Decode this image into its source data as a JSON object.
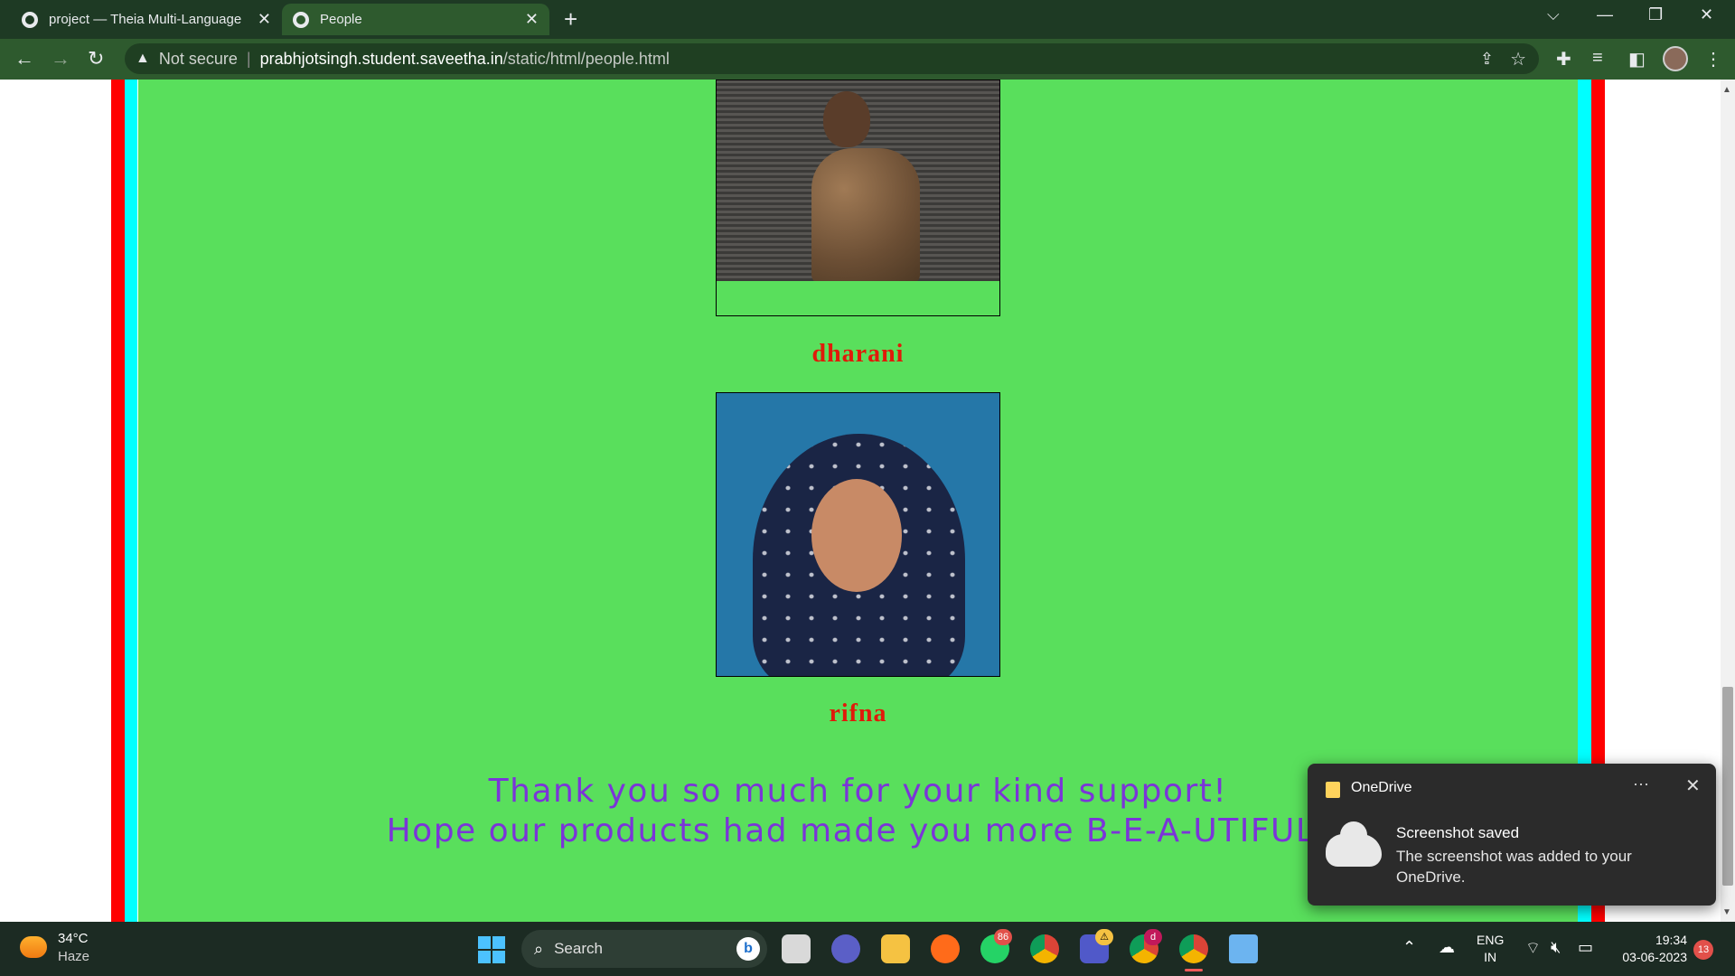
{
  "browser": {
    "tabs": [
      {
        "title": "project — Theia Multi-Language",
        "close": "✕"
      },
      {
        "title": "People",
        "close": "✕"
      }
    ],
    "new_tab": "+",
    "window_controls": {
      "dropdown": "⌵",
      "minimize": "—",
      "restore": "❐",
      "close": "✕"
    },
    "nav": {
      "back": "←",
      "forward": "→",
      "reload": "↻"
    },
    "address": {
      "warning_icon": "▲",
      "security_label": "Not secure",
      "separator": "|",
      "host": "prabhjotsingh.student.saveetha.in",
      "path": "/static/html/people.html"
    },
    "toolbar_icons": {
      "share": "⇪",
      "bookmark": "☆",
      "extensions": "✚",
      "media": "≡",
      "sidepanel": "◧",
      "menu": "⋮"
    }
  },
  "page": {
    "colors": {
      "background": "#59df5c",
      "name": "#e11a0a",
      "message": "#7b35d8",
      "left_stripe": "#ff0000",
      "inner_stripe": "#00ffff"
    },
    "people": [
      {
        "name": "dharani",
        "photo_alt": "Photo of dharani"
      },
      {
        "name": "rifna",
        "photo_alt": "Photo of rifna"
      }
    ],
    "message_line1": "Thank you so much for your kind support!",
    "message_line2": "Hope our products had made you more B-E-A-UTIFUL!"
  },
  "scrollbar": {
    "up": "▲",
    "down": "▼"
  },
  "notification": {
    "app": "OneDrive",
    "more": "···",
    "close": "✕",
    "title": "Screenshot saved",
    "body": "The screenshot was added to your OneDrive."
  },
  "taskbar": {
    "weather": {
      "temp": "34°C",
      "condition": "Haze"
    },
    "search": {
      "icon": "⌕",
      "label": "Search",
      "bing": "b"
    },
    "apps": [
      {
        "name": "task-view",
        "color": "#d9d9d9"
      },
      {
        "name": "meet",
        "color": "#5b5fc7"
      },
      {
        "name": "file-explorer",
        "color": "#f5c242"
      },
      {
        "name": "firefox",
        "color": "#ff6b1a"
      },
      {
        "name": "whatsapp",
        "color": "#25d366",
        "badge": "86"
      },
      {
        "name": "chrome",
        "color": "#db4437"
      },
      {
        "name": "teams",
        "color": "#5059c9",
        "badge": "⚠"
      },
      {
        "name": "chrome-profile",
        "color": "#34a853",
        "badge": "d"
      },
      {
        "name": "chrome-active",
        "color": "#4285f4"
      },
      {
        "name": "notepad",
        "color": "#6cb4f0"
      }
    ],
    "tray": {
      "chevron": "⌃",
      "onedrive": "☁",
      "lang1": "ENG",
      "lang2": "IN",
      "wifi": "⌔",
      "volume": "🔇︎",
      "battery": "▭"
    },
    "time": "19:34",
    "date": "03-06-2023",
    "notifications": "13"
  }
}
